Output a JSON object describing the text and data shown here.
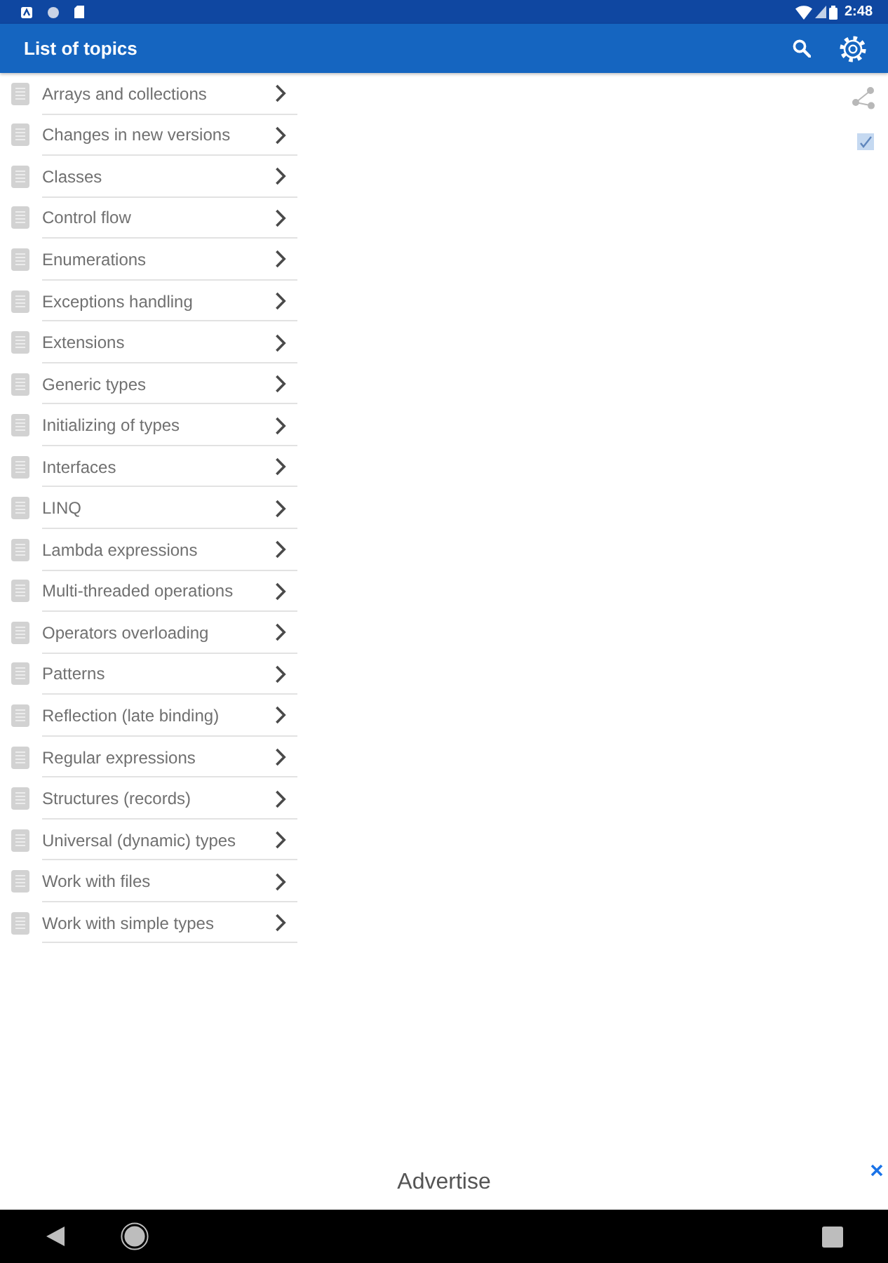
{
  "status_bar": {
    "time": "2:48"
  },
  "app_bar": {
    "title": "List of topics"
  },
  "topics": [
    "Arrays and collections",
    "Changes in new versions",
    "Classes",
    "Control flow",
    "Enumerations",
    "Exceptions handling",
    "Extensions",
    "Generic types",
    "Initializing of types",
    "Interfaces",
    "LINQ",
    "Lambda expressions",
    "Multi-threaded operations",
    "Operators overloading",
    "Patterns",
    "Reflection (late binding)",
    "Regular expressions",
    "Structures (records)",
    "Universal (dynamic) types",
    "Work with files",
    "Work with simple types"
  ],
  "ad_banner": {
    "text": "Advertise"
  }
}
